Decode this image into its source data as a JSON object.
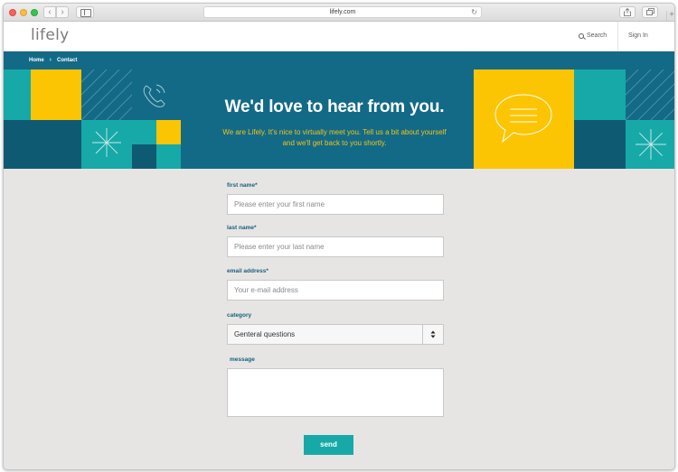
{
  "browser": {
    "url": "lifely.com"
  },
  "header": {
    "logo": "lifely",
    "search_label": "Search",
    "signin_label": "Sign In"
  },
  "breadcrumb": [
    "Home",
    "Contact"
  ],
  "hero": {
    "title": "We'd love to hear from you.",
    "subtitle": "We are Lifely. It's nice to virtually meet you. Tell us a bit about yourself and we'll get back to you shortly."
  },
  "form": {
    "first_name": {
      "label": "first name*",
      "placeholder": "Please enter your first name"
    },
    "last_name": {
      "label": "last name*",
      "placeholder": "Please enter your last name"
    },
    "email": {
      "label": "email address*",
      "placeholder": "Your e-mail address"
    },
    "category": {
      "label": "category",
      "selected": "Genteral questions"
    },
    "message": {
      "label": "message"
    },
    "send_label": "send"
  },
  "colors": {
    "hero_blue": "#136a86",
    "teal": "#17a9a8",
    "yellow": "#fcc503",
    "dark_blue": "#0f5a73",
    "page_bg": "#e7e5e4"
  }
}
